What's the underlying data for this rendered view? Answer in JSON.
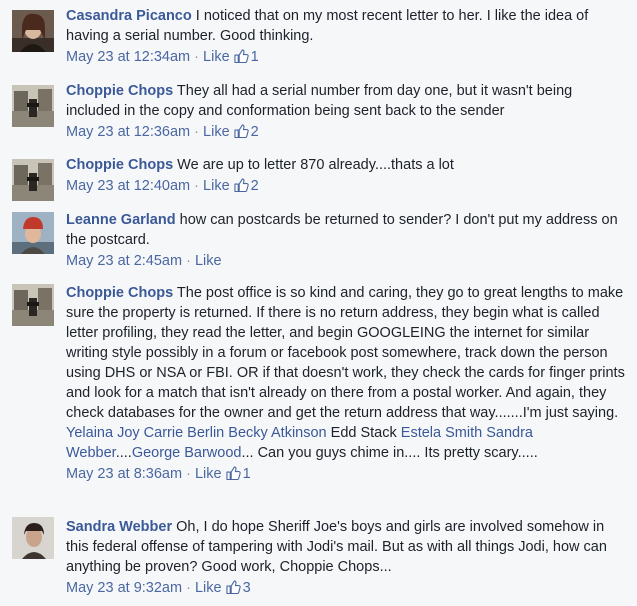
{
  "comments": [
    {
      "author": "Casandra Picanco",
      "text": "I noticed that on my most recent letter to her. I like the idea of having a serial number. Good thinking.",
      "time": "May 23 at 12:34am",
      "like_label": "Like",
      "likes": "1",
      "avatar_icon": "profile-photo-woman"
    },
    {
      "author": "Choppie Chops",
      "text": "They all had a serial number from day one, but it wasn't being included in the copy and conformation being sent back to the sender",
      "time": "May 23 at 12:36am",
      "like_label": "Like",
      "likes": "2",
      "avatar_icon": "profile-photo-street"
    },
    {
      "author": "Choppie Chops",
      "text": "We are up to letter 870 already....thats a lot",
      "time": "May 23 at 12:40am",
      "like_label": "Like",
      "likes": "2",
      "avatar_icon": "profile-photo-street"
    },
    {
      "author": "Leanne Garland",
      "text": "how can postcards be returned to sender? I don't put my address on the postcard.",
      "time": "May 23 at 2:45am",
      "like_label": "Like",
      "likes": "",
      "avatar_icon": "profile-photo-woman-red-hat"
    },
    {
      "author": "Choppie Chops",
      "text": "The post office is so kind and caring, they go to great lengths to make sure the property is returned. If there is no return address, they begin what is called letter profiling, they read the letter, and begin GOOGLEING the internet for similar writing style possibly in a forum or facebook post somewhere, track down the person using DHS or NSA or FBI. OR if that doesn't work, they check the cards for finger prints and look for a match that isn't already on there from a postal worker. And again, they check databases for the owner and get the return address that way.......I'm just saying.",
      "mentions": [
        {
          "text": "Yelaina Joy"
        },
        {
          "text": "Carrie Berlin"
        },
        {
          "text": "Becky Atkinson"
        }
      ],
      "text2": "Edd Stack",
      "mentions2": [
        {
          "text": "Estela Smith"
        },
        {
          "text": "Sandra Webber"
        }
      ],
      "text3": "....",
      "mention3": "George Barwood",
      "text4": "... Can you guys chime in.... Its pretty scary.....",
      "time": "May 23 at 8:36am",
      "like_label": "Like",
      "likes": "1",
      "avatar_icon": "profile-photo-street"
    },
    {
      "author": "Sandra Webber",
      "text": "Oh, I do hope Sheriff Joe's boys and girls are involved somehow in this federal offense of tampering with Jodi's mail. But as with all things Jodi, how can anything be proven? Good work, Choppie Chops...",
      "time": "May 23 at 9:32am",
      "like_label": "Like",
      "likes": "3",
      "avatar_icon": "profile-photo-woman-dark"
    }
  ],
  "separator": " · ",
  "colors": {
    "link": "#3b5998",
    "meta": "#90949c",
    "background": "#f6f7f9"
  }
}
